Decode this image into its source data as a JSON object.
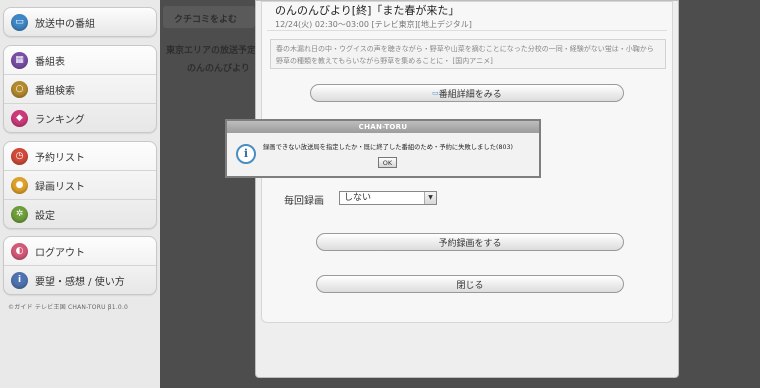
{
  "sidebar": {
    "groups": [
      [
        {
          "label": "放送中の番組",
          "icon": "tv-icon",
          "color": "#3f86c6"
        }
      ],
      [
        {
          "label": "番組表",
          "icon": "grid-icon",
          "color": "#7a4fa8"
        },
        {
          "label": "番組検索",
          "icon": "magnifier-icon",
          "color": "#b38a2e"
        },
        {
          "label": "ランキング",
          "icon": "medal-icon",
          "color": "#cc3a7a"
        }
      ],
      [
        {
          "label": "予約リスト",
          "icon": "clock-icon",
          "color": "#d24a3a"
        },
        {
          "label": "録画リスト",
          "icon": "coin-icon",
          "color": "#e0a12a"
        },
        {
          "label": "設定",
          "icon": "gear-icon",
          "color": "#6e9f3a"
        }
      ],
      [
        {
          "label": "ログアウト",
          "icon": "logout-icon",
          "color": "#d45a7a"
        },
        {
          "label": "要望・感想 / 使い方",
          "icon": "info-icon",
          "color": "#4f73b0"
        }
      ]
    ],
    "footer": "©ガイド テレビ王国 CHAN-TORU β1.0.0"
  },
  "background": {
    "kuchikomi": "クチコミをよむ",
    "area_line": "東京エリアの放送予定",
    "program_short": "のんのんびより"
  },
  "program": {
    "title": "のんのんびより[終]「また春が来た」",
    "meta": "12/24(火) 02:30～03:00 [テレビ東京][地上デジタル]",
    "description_line1": "春の木漏れ日の中・ウグイスの声を聴きながら・野草や山菜を摘むことになった分校の一同・経験がない蛍は・小鞠から",
    "description_line2": "野草の種類を教えてもらいながら野草を集めることに・ [国内アニメ]"
  },
  "detail_button": "番組詳細をみる",
  "repeat_record": {
    "label": "毎回録画",
    "value": "しない"
  },
  "reserve_button": "予約録画をする",
  "close_button": "閉じる",
  "dialog": {
    "title": "CHAN-TORU",
    "message": "録画できない放送局を指定したか・既に終了した番組のため・予約に失敗しました(803)",
    "ok": "OK"
  }
}
